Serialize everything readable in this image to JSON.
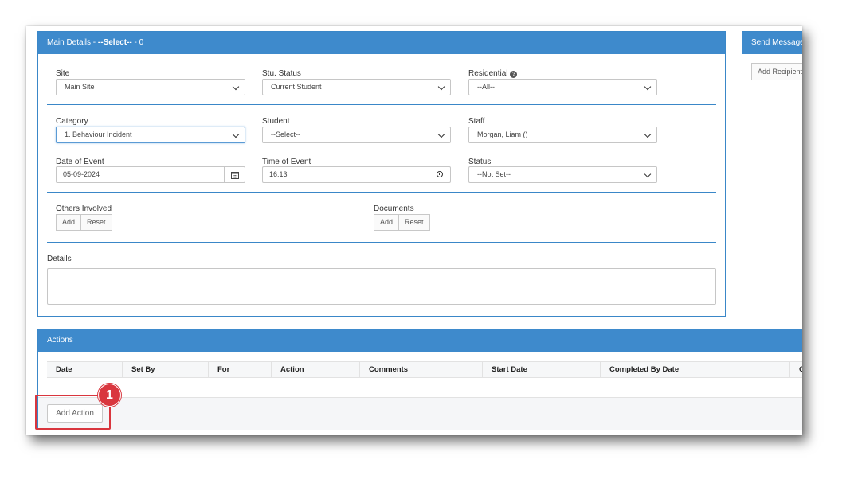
{
  "main_panel": {
    "title_prefix": "Main Details - ",
    "title_bold": "--Select--",
    "title_suffix": " - 0"
  },
  "send_panel": {
    "title": "Send Message",
    "add_recipient_label": "Add Recipient"
  },
  "fields": {
    "site": {
      "label": "Site",
      "value": "Main Site"
    },
    "stu_status": {
      "label": "Stu. Status",
      "value": "Current Student"
    },
    "residential": {
      "label": "Residential",
      "value": "--All--",
      "help_glyph": "?"
    },
    "category": {
      "label": "Category",
      "value": "1. Behaviour Incident"
    },
    "student": {
      "label": "Student",
      "value": "--Select--"
    },
    "staff": {
      "label": "Staff",
      "value": "Morgan, Liam ()"
    },
    "date_of_event": {
      "label": "Date of Event",
      "value": "05-09-2024"
    },
    "time_of_event": {
      "label": "Time of Event",
      "value": "16:13"
    },
    "status": {
      "label": "Status",
      "value": "--Not Set--"
    },
    "others_involved": {
      "label": "Others Involved",
      "add": "Add",
      "reset": "Reset"
    },
    "documents": {
      "label": "Documents",
      "add": "Add",
      "reset": "Reset"
    },
    "details": {
      "label": "Details",
      "value": ""
    }
  },
  "actions_panel": {
    "title": "Actions",
    "columns": [
      "Date",
      "Set By",
      "For",
      "Action",
      "Comments",
      "Start Date",
      "Completed By Date",
      "C"
    ],
    "add_action_label": "Add Action"
  },
  "annotation": {
    "step_number": "1",
    "color": "#d9363e"
  },
  "colors": {
    "header_blue": "#3e8acc",
    "divider_blue": "#3a87c8"
  },
  "icons": {
    "calendar": "calendar-icon",
    "clock": "clock-icon",
    "help": "help-icon",
    "dropdown": "chevron-down-icon"
  }
}
